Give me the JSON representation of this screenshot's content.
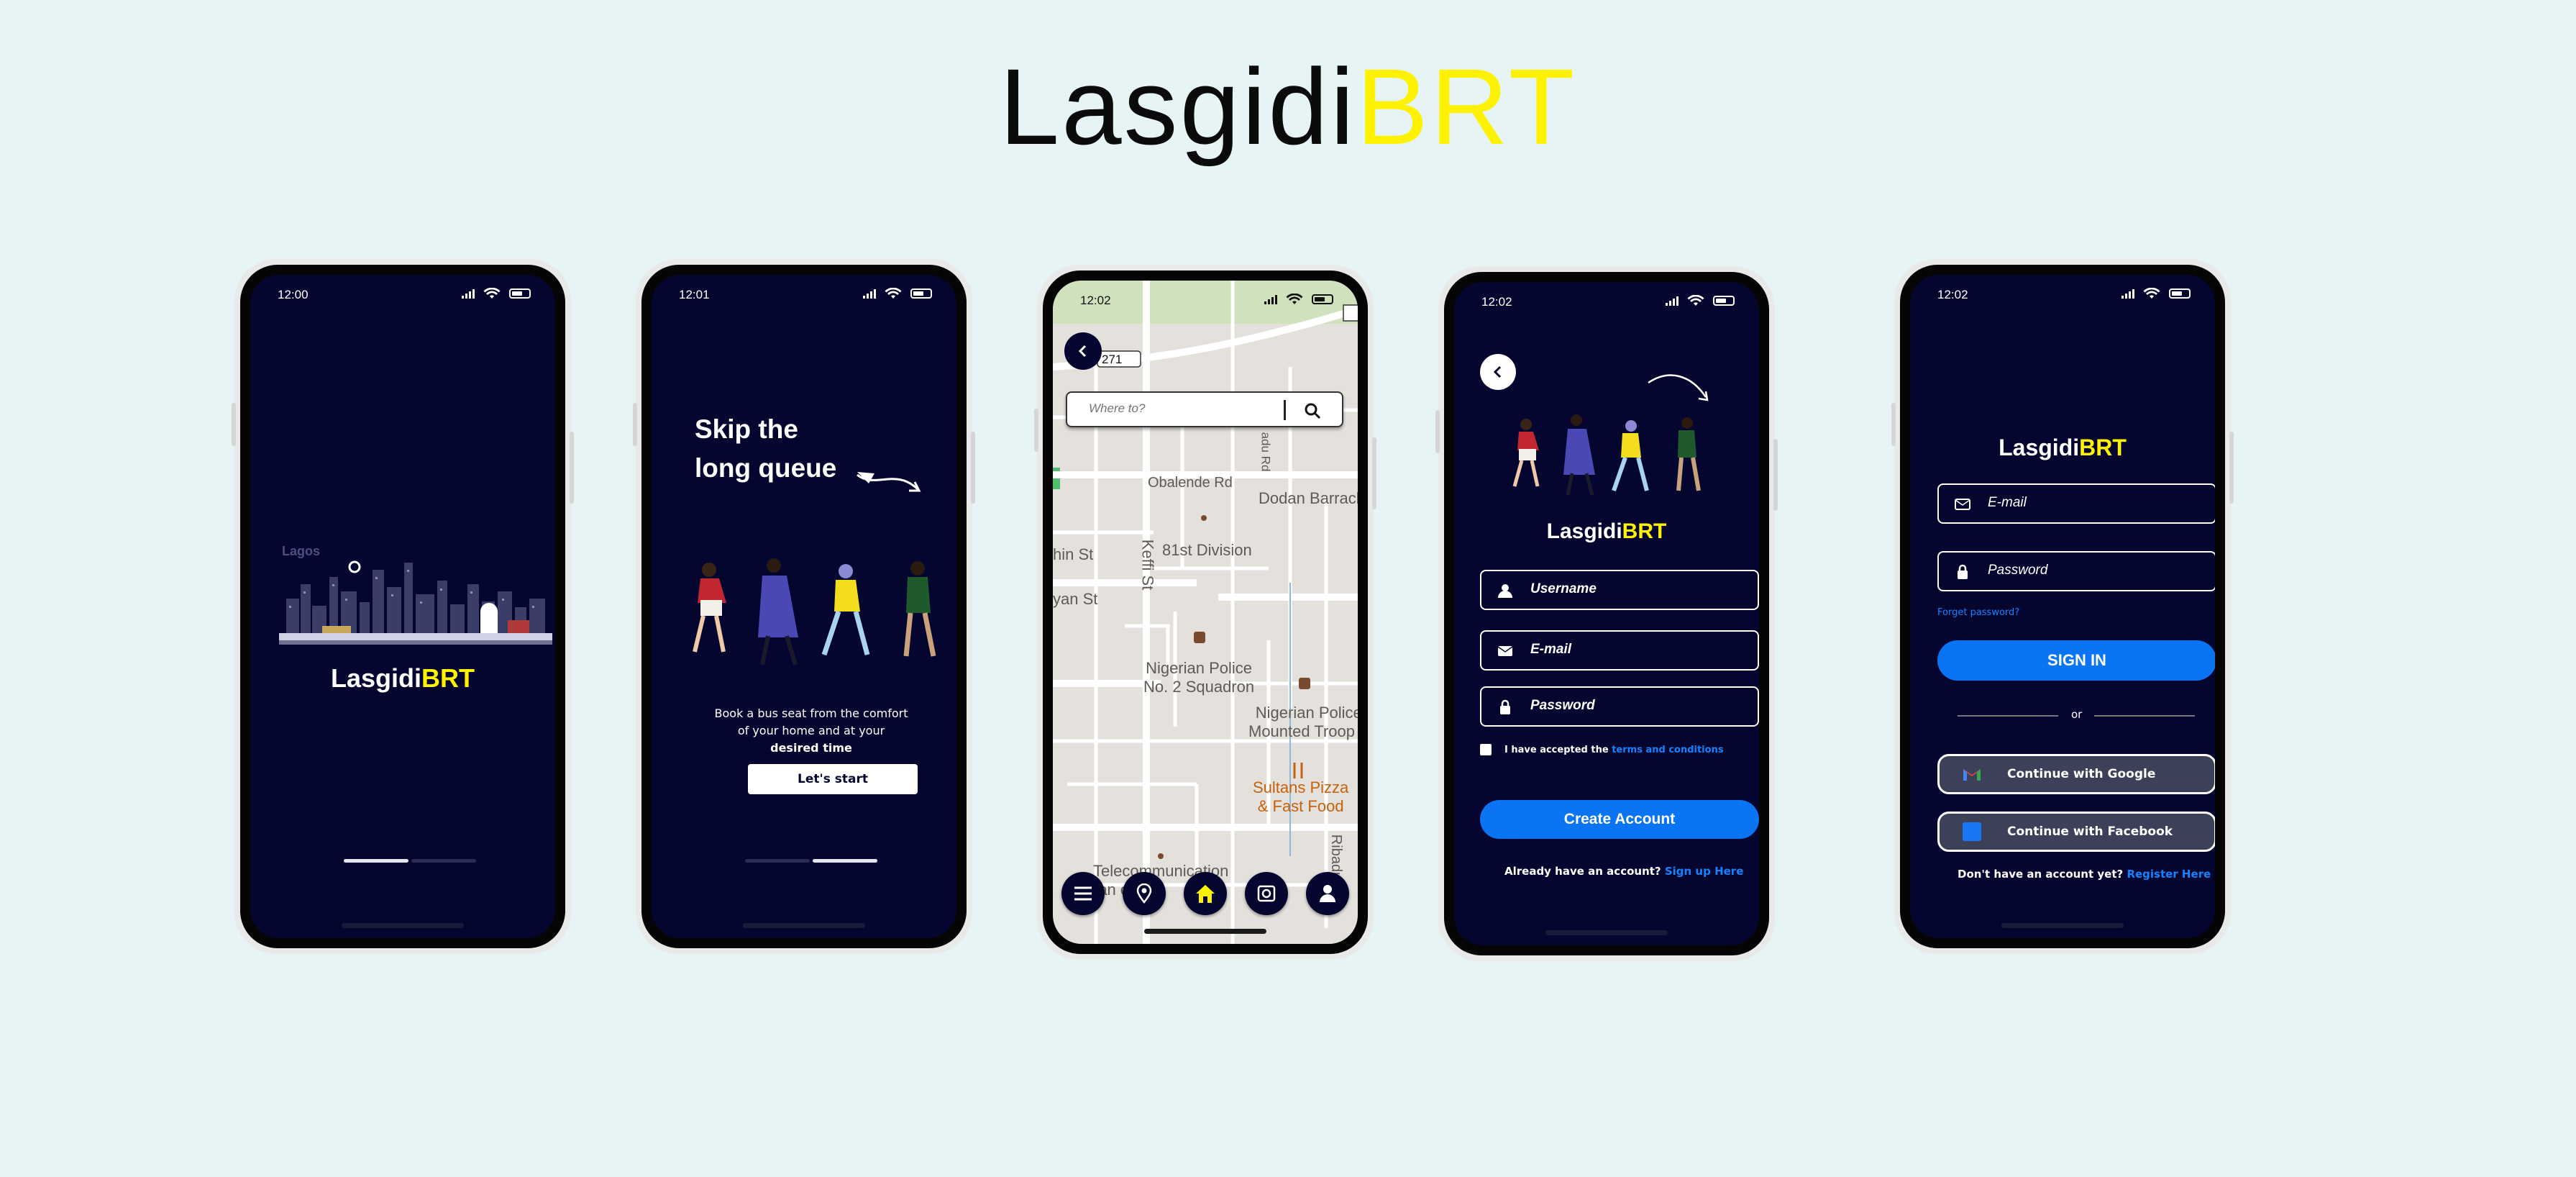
{
  "headline": {
    "part1": "Lasgidi",
    "part2": "BRT"
  },
  "brand": {
    "part1": "Lasgidi",
    "part2": "BRT",
    "accent_color": "#fff200"
  },
  "colors": {
    "background": "#e6f4f5",
    "screen": "#050630",
    "primary": "#0a74f2",
    "accent": "#fff200"
  },
  "screens": [
    {
      "id": "splash",
      "time": "12:00",
      "skyline_label": "Lagos",
      "pager_active": 0
    },
    {
      "id": "onboarding",
      "time": "12:01",
      "heading_line1": "Skip the",
      "heading_line2": "long queue",
      "tagline_line1": "Book a bus seat from the comfort",
      "tagline_line2": "of your home and at your",
      "tagline_line3": "desired time",
      "cta_label": "Let's start",
      "pager_active": 1
    },
    {
      "id": "map",
      "time": "12:02",
      "search_placeholder": "Where to?",
      "labels": {
        "route": "271",
        "obalende": "Obalende Rd",
        "dodan": "Dodan Barrack",
        "division": "81st Division",
        "thin": "hin St",
        "yan": "yan St",
        "keffi": "Keffi St",
        "police1a": "Nigerian Police",
        "police1b": "No. 2 Squadron",
        "police2a": "Nigerian Police",
        "police2b": "Mounted Troop F",
        "food1": "Sultans Pizza",
        "food2": "& Fast Food",
        "telecom1": "Telecommunication",
        "telecom2": "ran   of",
        "ribadu": "Ribadu R",
        "adu": "adu Rd"
      },
      "nav_icons": [
        "menu-icon",
        "location-pin-icon",
        "home-icon",
        "camera-icon",
        "user-icon"
      ]
    },
    {
      "id": "signup",
      "time": "12:02",
      "username_placeholder": "Username",
      "email_placeholder": "E-mail",
      "password_placeholder": "Password",
      "terms_prefix": "I have accepted the ",
      "terms_link": "terms and conditions",
      "create_label": "Create Account",
      "have_account": "Already have an account? ",
      "signup_link": "Sign up Here"
    },
    {
      "id": "signin",
      "time": "12:02",
      "email_placeholder": "E-mail",
      "password_placeholder": "Password",
      "forgot": "Forget password?",
      "signin_label": "SIGN IN",
      "or": "or",
      "google_label": "Continue with Google",
      "facebook_label": "Continue with Facebook",
      "no_account": "Don't have an account yet? ",
      "register_link": "Register Here"
    }
  ]
}
